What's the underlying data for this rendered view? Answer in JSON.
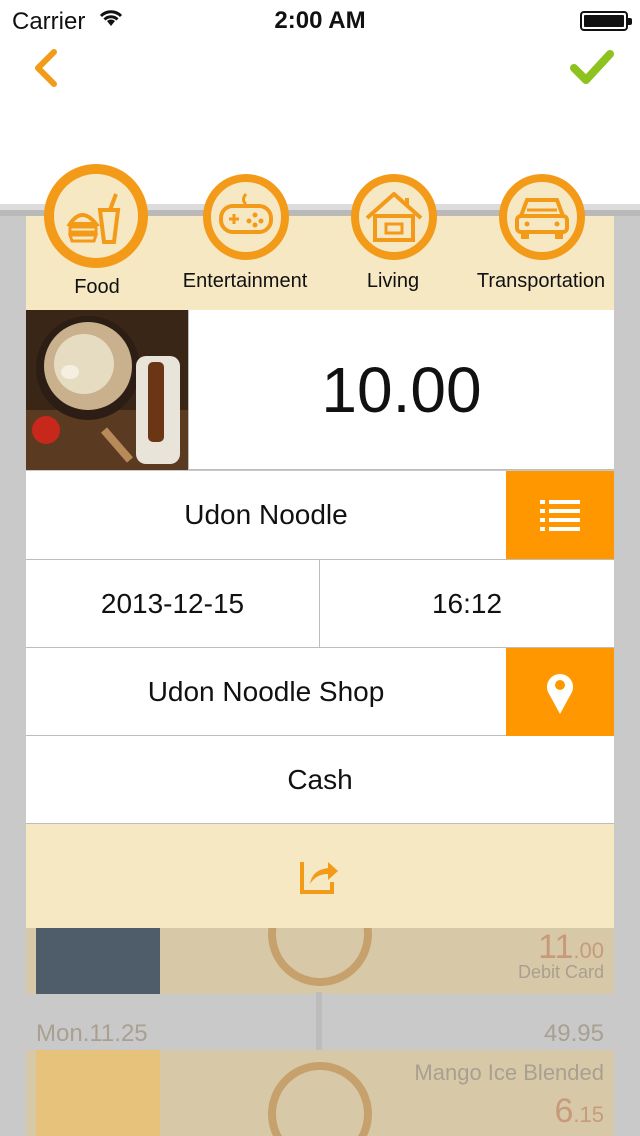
{
  "status_bar": {
    "carrier": "Carrier",
    "time": "2:00 AM"
  },
  "nav": {
    "back_icon": "chevron-left-icon",
    "confirm_icon": "checkmark-icon"
  },
  "colors": {
    "accent": "#f39a18",
    "confirm": "#8dc21f",
    "orange_button": "#ff9800",
    "panel": "#f7e8c4"
  },
  "categories": [
    {
      "label": "Food",
      "icon": "food-icon",
      "selected": true
    },
    {
      "label": "Entertainment",
      "icon": "gamepad-icon",
      "selected": false
    },
    {
      "label": "Living",
      "icon": "house-icon",
      "selected": false
    },
    {
      "label": "Transportation",
      "icon": "car-icon",
      "selected": false
    }
  ],
  "entry": {
    "amount": "10.00",
    "name": "Udon Noodle",
    "date": "2013-12-15",
    "time": "16:12",
    "place": "Udon Noodle Shop",
    "payment": "Cash"
  },
  "background_list": {
    "item1": {
      "amount_main": "11",
      "amount_cents": ".00",
      "payment": "Debit Card"
    },
    "day_header": {
      "date": "Mon.11.25",
      "total": "49.95"
    },
    "item2": {
      "name": "Mango Ice Blended",
      "amount_main": "6",
      "amount_cents": ".15"
    }
  }
}
